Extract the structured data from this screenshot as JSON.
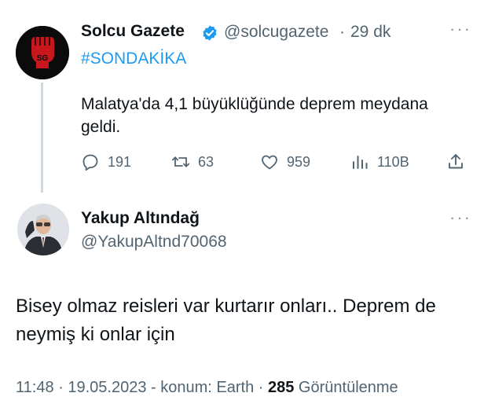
{
  "tweet1": {
    "author_name": "Solcu Gazete",
    "handle": "@solcugazete",
    "separator": "·",
    "time_ago": "29 dk",
    "hashtag": "#SONDAKİKA",
    "text": "Malatya'da 4,1 büyüklüğünde deprem meydana geldi.",
    "avatar_text": "SG",
    "more": "···",
    "stats": {
      "replies": "191",
      "retweets": "63",
      "likes": "959",
      "views": "110B"
    }
  },
  "tweet2": {
    "author_name": "Yakup Altındağ",
    "handle": "@YakupAltnd70068",
    "more": "···",
    "text": "Bisey olmaz reisleri var kurtarır onları.. Deprem de neymiş ki onlar için",
    "meta": {
      "time": "11:48",
      "date": "19.05.2023",
      "location": "konum: Earth",
      "views_count": "285",
      "views_label": "Görüntülenme",
      "sep1": " · ",
      "sep2": " - ",
      "sep3": " · "
    }
  },
  "colors": {
    "accent": "#1d9bf0",
    "text": "#0f1419",
    "secondary": "#536471",
    "logo_red": "#c8161d"
  },
  "icons": [
    "verified-badge-icon",
    "reply-icon",
    "retweet-icon",
    "like-icon",
    "views-icon",
    "share-icon",
    "more-icon"
  ]
}
